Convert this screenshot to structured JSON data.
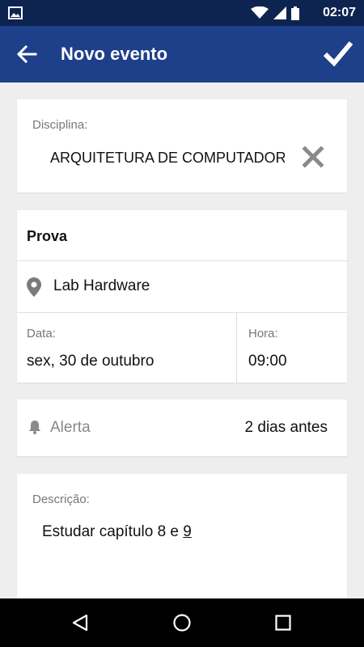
{
  "status_bar": {
    "time": "02:07"
  },
  "app_bar": {
    "title": "Novo evento"
  },
  "disciplina": {
    "label": "Disciplina:",
    "value": "ARQUITETURA DE COMPUTADOR"
  },
  "evento": {
    "type": "Prova",
    "location": "Lab Hardware",
    "date_label": "Data:",
    "date_value": "sex, 30 de outubro",
    "time_label": "Hora:",
    "time_value": "09:00"
  },
  "alerta": {
    "label": "Alerta",
    "value": "2 dias antes"
  },
  "descricao": {
    "label": "Descrição:",
    "text_main": "Estudar capítulo 8 e ",
    "text_underlined": "9"
  },
  "icons": {
    "status": [
      "image-icon",
      "wifi-icon",
      "signal-icon",
      "battery-icon"
    ],
    "app_bar": [
      "arrow-back-icon",
      "check-icon"
    ],
    "fields": [
      "close-x-icon",
      "location-pin-icon",
      "bell-icon"
    ],
    "nav": [
      "nav-back-icon",
      "nav-home-icon",
      "nav-recents-icon"
    ]
  },
  "colors": {
    "app_bar": "#1e3f8a",
    "status_bar": "#0d2450",
    "background": "#eeeeee",
    "card": "#ffffff"
  }
}
